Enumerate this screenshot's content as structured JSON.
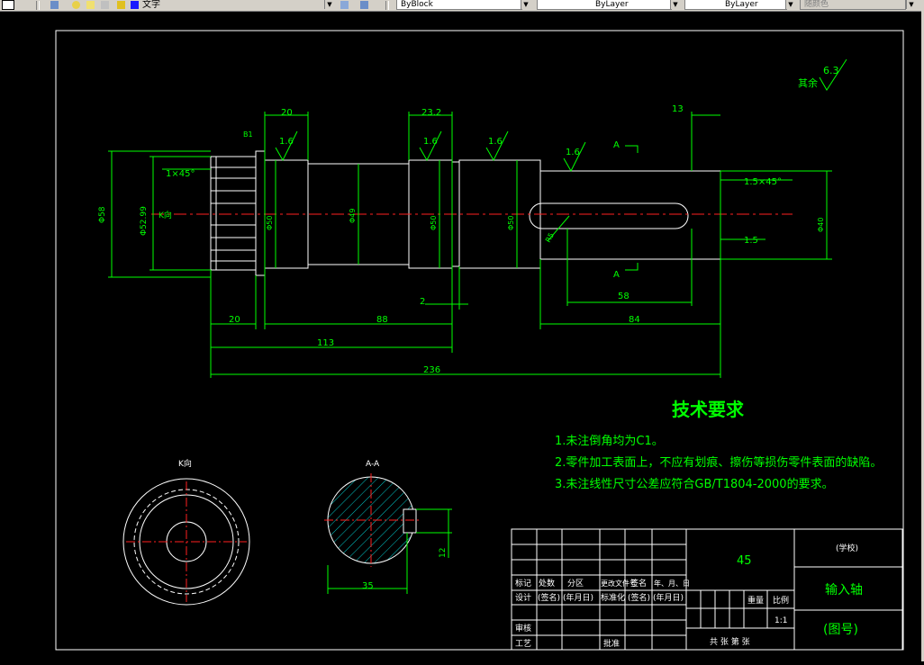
{
  "toolbar": {
    "text_style": "文字",
    "block_value": "ByBlock",
    "linetype_value": "ByLayer",
    "lineweight_value": "ByLayer",
    "color_value": "随颜色"
  },
  "drawing": {
    "roughness_rest_label": "其余",
    "roughness_rest_value": "6.3",
    "roughness_values": [
      "1.6",
      "1.6",
      "1.6",
      "1.6"
    ],
    "dims": {
      "d20_top": "20",
      "d23_2": "23.2",
      "d13": "13",
      "d81": "B1",
      "chamfer_left": "1×45°",
      "chamfer_right": "1.5×45°",
      "dia58": "Φ58",
      "dia52": "Φ52.99",
      "k_label": "K向",
      "dia50a": "Φ50",
      "dia49": "Φ49",
      "dia50b": "Φ50",
      "dia50c": "Φ50",
      "dia40": "Φ40",
      "key_depth": "1.5",
      "r_label": "R5",
      "d2": "2",
      "d58": "58",
      "d20_bot": "20",
      "d88": "88",
      "d84": "84",
      "d113": "113",
      "d236": "236",
      "sec_a_top": "A",
      "sec_a_bot": "A",
      "d35": "35",
      "d12": "12"
    },
    "view_k_title": "K向",
    "view_a_title": "A-A"
  },
  "tech": {
    "title": "技术要求",
    "notes": [
      "1.未注倒角均为C1。",
      "2.零件加工表面上，不应有划痕、擦伤等损伤零件表面的缺陷。",
      "3.未注线性尺寸公差应符合GB/T1804-2000的要求。"
    ]
  },
  "title_block": {
    "material": "45",
    "school": "(学校)",
    "part_name": "输入轴",
    "drawing_no": "(图号)",
    "row_header": [
      "标记",
      "处数",
      "分区",
      "更改文件号",
      "签名",
      "年、月、日"
    ],
    "row_design": [
      "设计",
      "(签名)",
      "(年月日)",
      "标准化",
      "(签名)",
      "(年月日)"
    ],
    "review": "审核",
    "process": "工艺",
    "approve": "批准",
    "weight": "重量",
    "scale": "比例",
    "scale_value": "1:1",
    "sheets": "共  张  第  张"
  }
}
